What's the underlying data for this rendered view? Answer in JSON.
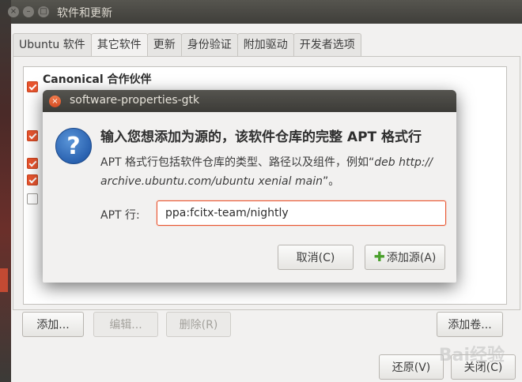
{
  "window": {
    "title": "软件和更新",
    "controls": {
      "close": "×",
      "minimize": "–",
      "maximize": "□"
    }
  },
  "tabs": [
    {
      "label": "Ubuntu 软件",
      "active": false
    },
    {
      "label": "其它软件",
      "active": true
    },
    {
      "label": "更新",
      "active": false
    },
    {
      "label": "身份验证",
      "active": false
    },
    {
      "label": "附加驱动",
      "active": false
    },
    {
      "label": "开发者选项",
      "active": false
    }
  ],
  "source_list": {
    "items": [
      {
        "label": "Canonical 合作伙伴",
        "checked": true
      },
      {
        "label": "",
        "checked": true
      },
      {
        "label": "",
        "checked": true
      },
      {
        "label": "",
        "checked": true
      },
      {
        "label": "",
        "checked": false
      }
    ]
  },
  "panel_buttons": {
    "add": "添加...",
    "edit": "编辑...",
    "remove": "删除(R)",
    "add_volume": "添加卷..."
  },
  "bottom_buttons": {
    "revert": "还原(V)",
    "close": "关闭(C)"
  },
  "dialog": {
    "title": "software-properties-gtk",
    "heading": "输入您想添加为源的，该软件仓库的完整 APT 格式行",
    "body_prefix": "APT 格式行包括软件仓库的类型、路径以及组件，例如“",
    "body_example_1": "deb http://",
    "body_example_2": "archive.ubuntu.com/ubuntu xenial main",
    "body_suffix": "”。",
    "apt_label": "APT 行:",
    "apt_value": "ppa:fcitx-team/nightly",
    "cancel": "取消(C)",
    "add_source": "添加源(A)",
    "icons": {
      "question": "question-icon",
      "close": "close-icon",
      "add": "plus-icon"
    }
  },
  "watermark": "Bai经验",
  "colors": {
    "accent": "#e9552f",
    "titlebar": "#3f3e3a",
    "window_bg": "#f2f1f0"
  }
}
